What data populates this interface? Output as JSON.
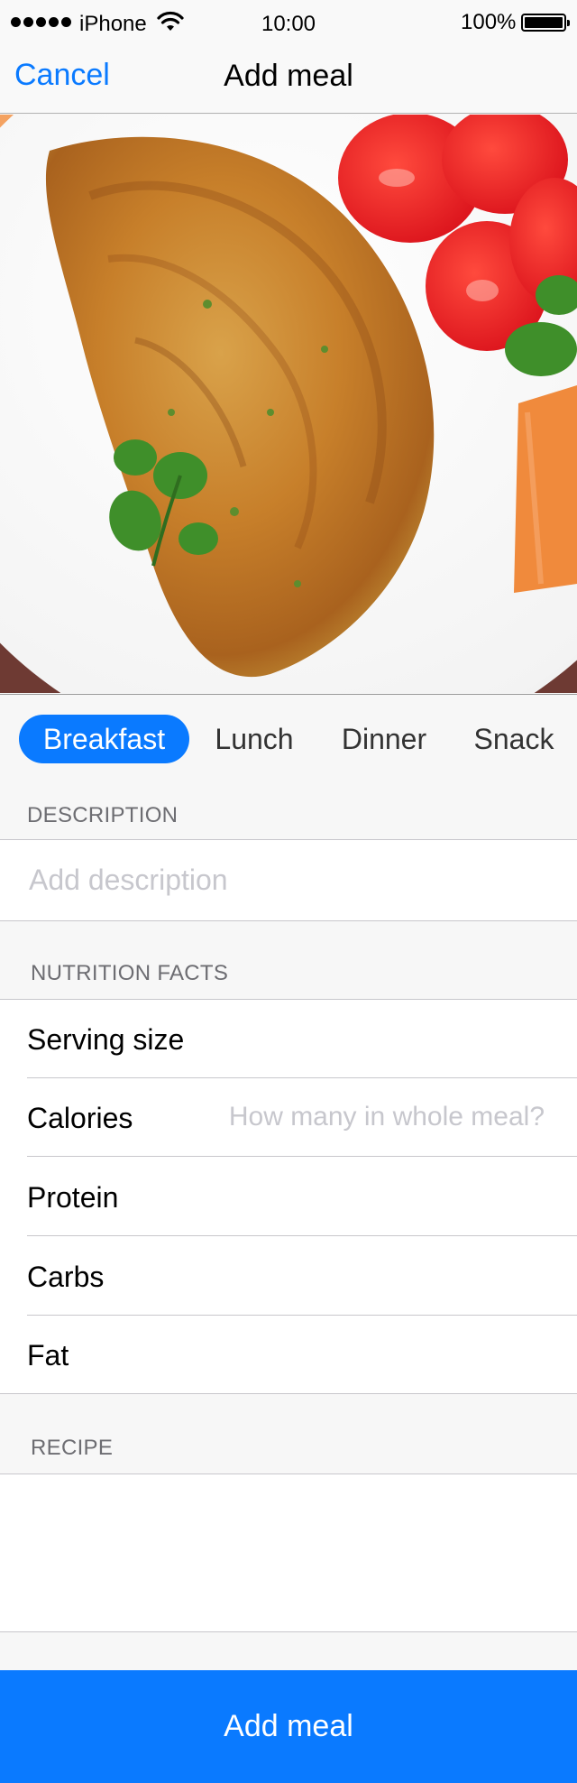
{
  "status_bar": {
    "carrier": "iPhone",
    "time": "10:00",
    "battery": "100%"
  },
  "nav": {
    "cancel_label": "Cancel",
    "title": "Add meal"
  },
  "meal_types": {
    "items": [
      "Breakfast",
      "Lunch",
      "Dinner",
      "Snack"
    ],
    "selected": "Breakfast"
  },
  "description": {
    "header": "DESCRIPTION",
    "placeholder": "Add description",
    "value": ""
  },
  "nutrition": {
    "header": "NUTRITION FACTS",
    "rows": [
      {
        "label": "Serving size",
        "placeholder": ""
      },
      {
        "label": "Calories",
        "placeholder": "How many in whole meal?"
      },
      {
        "label": "Protein",
        "placeholder": ""
      },
      {
        "label": "Carbs",
        "placeholder": ""
      },
      {
        "label": "Fat",
        "placeholder": ""
      }
    ]
  },
  "recipe": {
    "header": "RECIPE",
    "value": ""
  },
  "footer": {
    "add_label": "Add meal"
  },
  "colors": {
    "accent": "#0a7aff",
    "placeholder": "#c7c7cd",
    "section_header": "#6d6d72"
  },
  "icons": {
    "signal": "signal-dots-icon",
    "wifi": "wifi-icon",
    "battery": "battery-icon"
  }
}
